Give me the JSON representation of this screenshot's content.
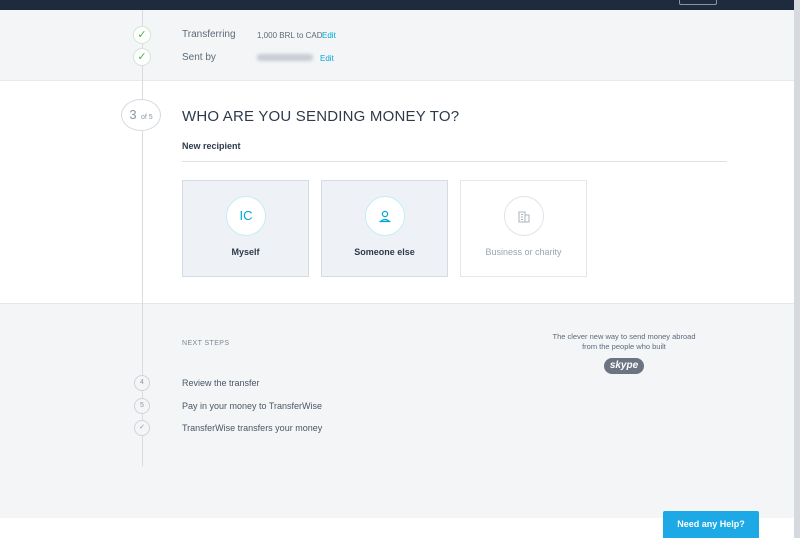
{
  "summary": {
    "transferring_label": "Transferring",
    "transferring_value": "1,000 BRL to CAD",
    "sent_by_label": "Sent by",
    "edit_label": "Edit"
  },
  "step": {
    "current": "3",
    "of": "of 5"
  },
  "main": {
    "heading": "WHO ARE YOU SENDING MONEY TO?",
    "subheading": "New recipient",
    "options": [
      {
        "icon": "IC",
        "label": "Myself"
      },
      {
        "icon": "person-icon",
        "label": "Someone else"
      },
      {
        "icon": "building-icon",
        "label": "Business or charity"
      }
    ]
  },
  "next_steps": {
    "title": "NEXT STEPS",
    "items": [
      {
        "marker": "4",
        "label": "Review the transfer"
      },
      {
        "marker": "5",
        "label": "Pay in your money to TransferWise"
      },
      {
        "marker": "check-icon",
        "label": "TransferWise transfers your money"
      }
    ]
  },
  "promo": {
    "line1": "The clever new way to send money abroad",
    "line2": "from the people who built",
    "logo": "skype"
  },
  "help_button": "Need any Help?",
  "colors": {
    "accent": "#00a8d6",
    "success": "#4caf50",
    "navy": "#1e2a3e",
    "help": "#1da9e6"
  }
}
